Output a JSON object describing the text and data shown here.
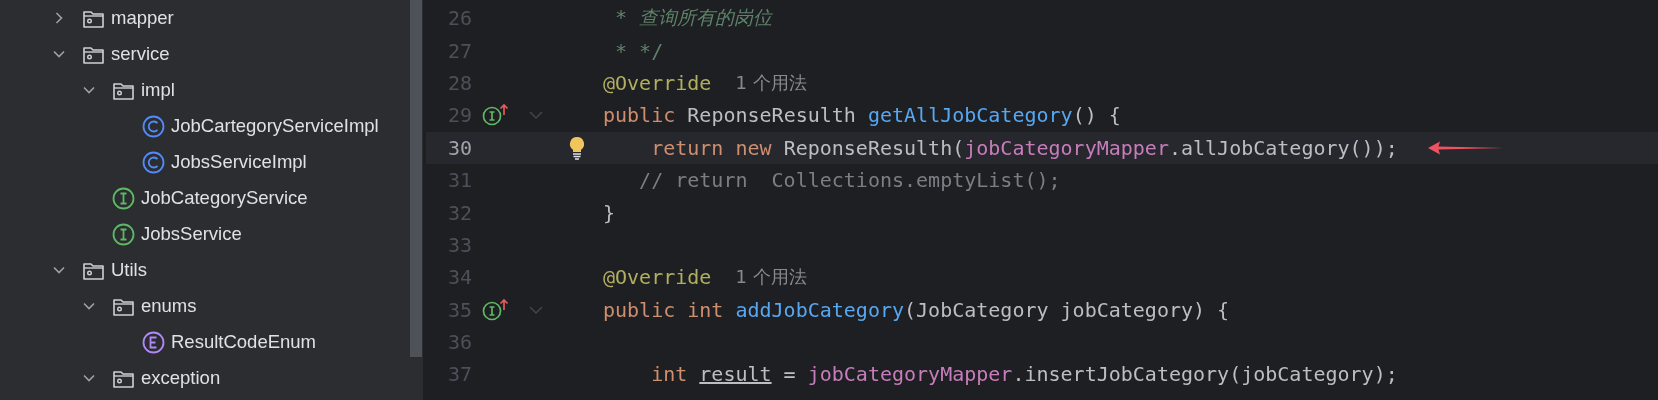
{
  "project_tree": [
    {
      "kind": "folder",
      "label": "mapper",
      "expanded": false
    },
    {
      "kind": "folder",
      "label": "service",
      "expanded": true,
      "children": [
        {
          "kind": "folder",
          "label": "impl",
          "expanded": true,
          "children": [
            {
              "kind": "class",
              "label": "JobCartegoryServiceImpl"
            },
            {
              "kind": "class",
              "label": "JobsServiceImpl"
            }
          ]
        },
        {
          "kind": "interface",
          "label": "JobCategoryService"
        },
        {
          "kind": "interface",
          "label": "JobsService"
        }
      ]
    },
    {
      "kind": "folder",
      "label": "Utils",
      "expanded": true,
      "children": [
        {
          "kind": "folder",
          "label": "enums",
          "expanded": true,
          "children": [
            {
              "kind": "enum",
              "label": "ResultCodeEnum"
            }
          ]
        },
        {
          "kind": "folder",
          "label": "exception",
          "expanded": true
        }
      ]
    }
  ],
  "editor": {
    "lines": [
      {
        "number": "26",
        "selected": false,
        "implements": false,
        "foldable": false,
        "bulb": false,
        "arrow": false,
        "tokens": [
          {
            "kind": "doc",
            "text": " * "
          },
          {
            "kind": "doc-text",
            "text": "查询所有的岗位"
          }
        ]
      },
      {
        "number": "27",
        "selected": false,
        "implements": false,
        "foldable": false,
        "bulb": false,
        "arrow": false,
        "tokens": [
          {
            "kind": "doc",
            "text": " * */"
          }
        ]
      },
      {
        "number": "28",
        "selected": false,
        "implements": false,
        "foldable": false,
        "bulb": false,
        "arrow": false,
        "tokens": [
          {
            "kind": "annotation",
            "text": "@Override"
          }
        ],
        "hint": "1 个用法"
      },
      {
        "number": "29",
        "selected": false,
        "implements": true,
        "foldable": true,
        "bulb": false,
        "arrow": false,
        "tokens": [
          {
            "kind": "keyword",
            "text": "public "
          },
          {
            "kind": "plain",
            "text": "ReponseResulth "
          },
          {
            "kind": "method",
            "text": "getAllJobCategory"
          },
          {
            "kind": "plain",
            "text": "() {"
          }
        ]
      },
      {
        "number": "30",
        "selected": true,
        "implements": false,
        "foldable": false,
        "bulb": true,
        "arrow": true,
        "tokens": [
          {
            "kind": "keyword",
            "text": "    return new "
          },
          {
            "kind": "plain",
            "text": "ReponseResulth("
          },
          {
            "kind": "field",
            "text": "jobCategoryMapper"
          },
          {
            "kind": "plain",
            "text": ".allJobCategory());"
          }
        ]
      },
      {
        "number": "31",
        "selected": false,
        "implements": false,
        "foldable": false,
        "bulb": false,
        "arrow": false,
        "tokens": [
          {
            "kind": "comment",
            "text": "   // return  Collections.emptyList();"
          }
        ]
      },
      {
        "number": "32",
        "selected": false,
        "implements": false,
        "foldable": false,
        "bulb": false,
        "arrow": false,
        "tokens": [
          {
            "kind": "plain",
            "text": "}"
          }
        ]
      },
      {
        "number": "33",
        "selected": false,
        "implements": false,
        "foldable": false,
        "bulb": false,
        "arrow": false
      },
      {
        "number": "34",
        "selected": false,
        "implements": false,
        "foldable": false,
        "bulb": false,
        "arrow": false,
        "tokens": [
          {
            "kind": "annotation",
            "text": "@Override"
          }
        ],
        "hint": "1 个用法"
      },
      {
        "number": "35",
        "selected": false,
        "implements": true,
        "foldable": true,
        "bulb": false,
        "arrow": false,
        "tokens": [
          {
            "kind": "keyword",
            "text": "public int "
          },
          {
            "kind": "method",
            "text": "addJobCategory"
          },
          {
            "kind": "plain",
            "text": "(JobCategory jobCategory) {"
          }
        ]
      },
      {
        "number": "36",
        "selected": false,
        "implements": false,
        "foldable": false,
        "bulb": false,
        "arrow": false
      },
      {
        "number": "37",
        "selected": false,
        "implements": false,
        "foldable": false,
        "bulb": false,
        "arrow": false,
        "tokens": [
          {
            "kind": "keyword",
            "text": "    int "
          },
          {
            "kind": "local-underlined",
            "text": "result"
          },
          {
            "kind": "plain",
            "text": " = "
          },
          {
            "kind": "field",
            "text": "jobCategoryMapper"
          },
          {
            "kind": "plain",
            "text": ".insertJobCategory(jobCategory);"
          }
        ]
      }
    ]
  }
}
